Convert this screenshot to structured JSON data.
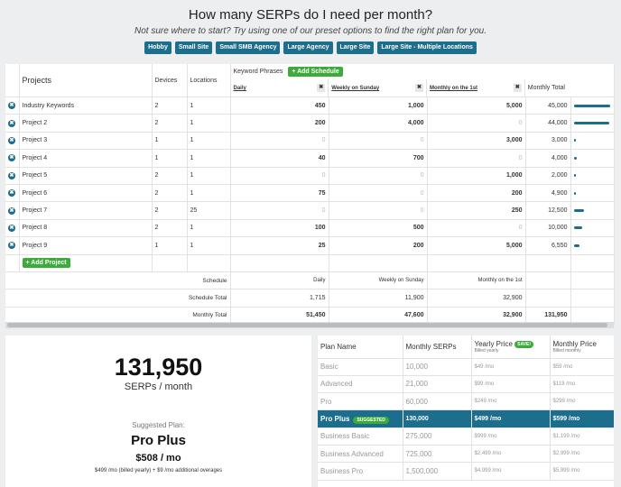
{
  "header": {
    "title": "How many SERPs do I need per month?",
    "subtitle": "Not sure where to start? Try using one of our preset options to find the right plan for you.",
    "presets": [
      "Hobby",
      "Small Site",
      "Small SMB Agency",
      "Large Agency",
      "Large Site",
      "Large Site - Multiple Locations"
    ]
  },
  "grid": {
    "col_projects": "Projects",
    "col_devices": "Devices",
    "col_locations": "Locations",
    "keyword_phrases": "Keyword Phrases",
    "add_schedule": "+ Add Schedule",
    "col_daily": "Daily",
    "col_weekly": "Weekly on Sunday",
    "col_monthly": "Monthly on the 1st",
    "col_total": "Monthly Total",
    "remove_glyph": "✖",
    "rows": [
      {
        "name": "Industry Keywords",
        "devices": "2",
        "locations": "1",
        "daily": "450",
        "weekly": "1,000",
        "monthly": "5,000",
        "total": "45,000",
        "share": 0.98
      },
      {
        "name": "Project 2",
        "devices": "2",
        "locations": "1",
        "daily": "200",
        "weekly": "4,000",
        "monthly": "0",
        "total": "44,000",
        "share": 0.96
      },
      {
        "name": "Project 3",
        "devices": "1",
        "locations": "1",
        "daily": "0",
        "weekly": "0",
        "monthly": "3,000",
        "total": "3,000",
        "share": 0.07
      },
      {
        "name": "Project 4",
        "devices": "1",
        "locations": "1",
        "daily": "40",
        "weekly": "700",
        "monthly": "0",
        "total": "4,000",
        "share": 0.09
      },
      {
        "name": "Project 5",
        "devices": "2",
        "locations": "1",
        "daily": "0",
        "weekly": "0",
        "monthly": "1,000",
        "total": "2,000",
        "share": 0.05
      },
      {
        "name": "Project 6",
        "devices": "2",
        "locations": "1",
        "daily": "75",
        "weekly": "0",
        "monthly": "200",
        "total": "4,900",
        "share": 0.06
      },
      {
        "name": "Project 7",
        "devices": "2",
        "locations": "25",
        "daily": "0",
        "weekly": "0",
        "monthly": "250",
        "total": "12,500",
        "share": 0.28
      },
      {
        "name": "Project 8",
        "devices": "2",
        "locations": "1",
        "daily": "100",
        "weekly": "500",
        "monthly": "0",
        "total": "10,000",
        "share": 0.22
      },
      {
        "name": "Project 9",
        "devices": "1",
        "locations": "1",
        "daily": "25",
        "weekly": "200",
        "monthly": "5,000",
        "total": "6,550",
        "share": 0.15
      }
    ],
    "add_project": "+ Add Project",
    "footer": {
      "schedule_label": "Schedule",
      "schedule_daily": "Daily",
      "schedule_weekly": "Weekly on Sunday",
      "schedule_monthly": "Monthly on the 1st",
      "schedule_total_label": "Schedule Total",
      "schedule_total_daily": "1,715",
      "schedule_total_weekly": "11,900",
      "schedule_total_monthly": "32,900",
      "monthly_total_label": "Monthly Total",
      "monthly_total_daily": "51,450",
      "monthly_total_weekly": "47,600",
      "monthly_total_monthly": "32,900",
      "monthly_total_grand": "131,950"
    }
  },
  "summary": {
    "serps": "131,950",
    "serps_label": "SERPs / month",
    "suggested_label": "Suggested Plan:",
    "plan": "Pro Plus",
    "price": "$508 / mo",
    "note": "$499 /mo (billed yearly) + $9 /mo additional overages"
  },
  "plans": {
    "col_name": "Plan Name",
    "col_serps": "Monthly SERPs",
    "col_yearly": "Yearly Price",
    "saved_badge": "SAVE!",
    "yearly_note": "Billed yearly",
    "col_monthly": "Monthly Price",
    "monthly_note": "Billed monthly",
    "suggested_badge": "SUGGESTED",
    "rows": [
      {
        "name": "Basic",
        "serps": "10,000",
        "yearly": "$49 /mo",
        "monthly": "$59 /mo"
      },
      {
        "name": "Advanced",
        "serps": "21,000",
        "yearly": "$99 /mo",
        "monthly": "$119 /mo"
      },
      {
        "name": "Pro",
        "serps": "60,000",
        "yearly": "$249 /mo",
        "monthly": "$299 /mo"
      },
      {
        "name": "Pro Plus",
        "serps": "130,000",
        "yearly": "$499 /mo",
        "monthly": "$599 /mo",
        "highlight": true
      },
      {
        "name": "Business Basic",
        "serps": "275,000",
        "yearly": "$999 /mo",
        "monthly": "$1,199 /mo"
      },
      {
        "name": "Business Advanced",
        "serps": "725,000",
        "yearly": "$2,499 /mo",
        "monthly": "$2,999 /mo"
      },
      {
        "name": "Business Pro",
        "serps": "1,500,000",
        "yearly": "$4,999 /mo",
        "monthly": "$5,999 /mo"
      }
    ]
  },
  "colors": {
    "accent": "#1c6e8c",
    "green": "#3cab3b"
  }
}
